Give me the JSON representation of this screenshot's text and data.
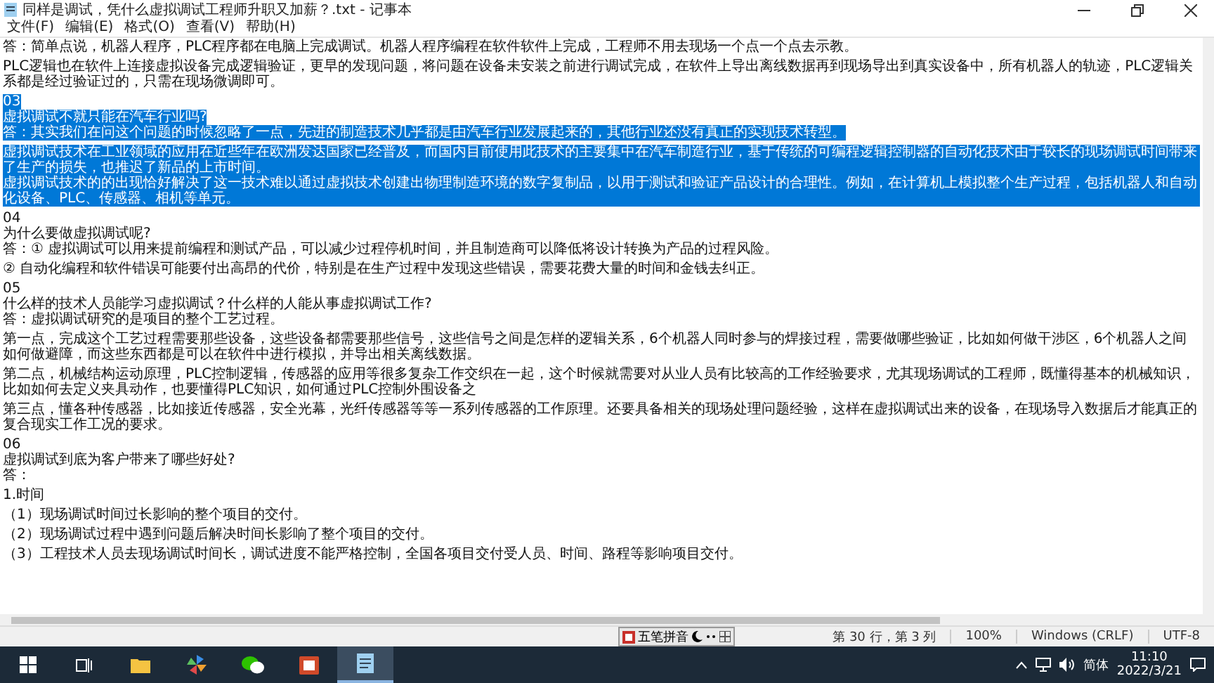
{
  "window": {
    "title": "同样是调试，凭什么虚拟调试工程师升职又加薪？.txt - 记事本"
  },
  "menu": [
    {
      "label": "文件(F)"
    },
    {
      "label": "编辑(E)"
    },
    {
      "label": "格式(O)"
    },
    {
      "label": "查看(V)"
    },
    {
      "label": "帮助(H)"
    }
  ],
  "document": {
    "blocks": [
      {
        "lines": [
          {
            "text": "答：简单点说，机器人程序，PLC程序都在电脑上完成调试。机器人程序编程在软件软件上完成，工程师不用去现场一个点一个点去示教。",
            "selected": false
          }
        ]
      },
      {
        "lines": [
          {
            "text": "PLC逻辑也在软件上连接虚拟设备完成逻辑验证，更早的发现问题，将问题在设备未安装之前进行调试完成，在软件上导出离线数据再到现场导出到真实设备中，所有机器人的轨迹，PLC逻辑关系都是经过验证过的，只需在现场微调即可。",
            "selected": false
          }
        ]
      },
      {
        "lines": [
          {
            "text": "03",
            "selected": true
          },
          {
            "text": "虚拟调试不就只能在汽车行业吗?",
            "selected": true
          },
          {
            "text": "答：其实我们在问这个问题的时候忽略了一点，先进的制造技术几乎都是由汽车行业发展起来的，其他行业还没有真正的实现技术转型。",
            "selected": true
          }
        ]
      },
      {
        "lines": [
          {
            "text": "虚拟调试技术在工业领域的应用在近些年在欧洲发达国家已经普及，而国内目前使用此技术的主要集中在汽车制造行业，基于传统的可编程逻辑控制器的自动化技术由于较长的现场调试时间带来了生产的损失，也推迟了新品的上市时间。",
            "selected": true
          },
          {
            "text": "虚拟调试技术的的出现恰好解决了这一技术难以通过虚拟技术创建出物理制造环境的数字复制品，以用于测试和验证产品设计的合理性。例如，在计算机上模拟整个生产过程，包括机器人和自动化设备、PLC、传感器、相机等单元。",
            "selected": true
          }
        ]
      },
      {
        "lines": [
          {
            "text": "04",
            "selected": false
          },
          {
            "text": "为什么要做虚拟调试呢?",
            "selected": false
          },
          {
            "text": "答：① 虚拟调试可以用来提前编程和测试产品，可以减少过程停机时间，并且制造商可以降低将设计转换为产品的过程风险。",
            "selected": false
          }
        ]
      },
      {
        "lines": [
          {
            "text": "② 自动化编程和软件错误可能要付出高昂的代价，特别是在生产过程中发现这些错误，需要花费大量的时间和金钱去纠正。",
            "selected": false
          }
        ]
      },
      {
        "lines": [
          {
            "text": "05",
            "selected": false
          },
          {
            "text": "什么样的技术人员能学习虚拟调试？什么样的人能从事虚拟调试工作?",
            "selected": false
          },
          {
            "text": "答：虚拟调试研究的是项目的整个工艺过程。",
            "selected": false
          }
        ]
      },
      {
        "lines": [
          {
            "text": "第一点，完成这个工艺过程需要那些设备，这些设备都需要那些信号，这些信号之间是怎样的逻辑关系，6个机器人同时参与的焊接过程，需要做哪些验证，比如如何做干涉区，6个机器人之间如何做避障，而这些东西都是可以在软件中进行模拟，并导出相关离线数据。",
            "selected": false
          }
        ]
      },
      {
        "lines": [
          {
            "text": "第二点，机械结构运动原理，PLC控制逻辑，传感器的应用等很多复杂工作交织在一起，这个时候就需要对从业人员有比较高的工作经验要求，尤其现场调试的工程师，既懂得基本的机械知识，比如如何去定义夹具动作，也要懂得PLC知识，如何通过PLC控制外围设备之",
            "selected": false
          }
        ]
      },
      {
        "lines": [
          {
            "text": "第三点，懂各种传感器，比如接近传感器，安全光幕，光纤传感器等等一系列传感器的工作原理。还要具备相关的现场处理问题经验，这样在虚拟调试出来的设备，在现场导入数据后才能真正的复合现实工作工况的要求。",
            "selected": false
          }
        ]
      },
      {
        "lines": [
          {
            "text": "06",
            "selected": false
          },
          {
            "text": "虚拟调试到底为客户带来了哪些好处?",
            "selected": false
          },
          {
            "text": "答：",
            "selected": false
          }
        ]
      },
      {
        "lines": [
          {
            "text": "1.时间",
            "selected": false
          }
        ]
      },
      {
        "lines": [
          {
            "text": "（1）现场调试时间过长影响的整个项目的交付。",
            "selected": false
          }
        ]
      },
      {
        "lines": [
          {
            "text": "（2）现场调试过程中遇到问题后解决时间长影响了整个项目的交付。",
            "selected": false
          }
        ]
      },
      {
        "lines": [
          {
            "text": "（3）工程技术人员去现场调试时间长，调试进度不能严格控制，全国各项目交付受人员、时间、路程等影响项目交付。",
            "selected": false
          }
        ]
      }
    ]
  },
  "ime_bar": {
    "label": "五笔拼音"
  },
  "status_bar": {
    "position": "第 30 行，第 3 列",
    "zoom": "100%",
    "line_ending": "Windows (CRLF)",
    "encoding": "UTF-8"
  },
  "taskbar": {
    "apps": [
      {
        "kind": "explorer",
        "active": false
      },
      {
        "kind": "pinwheel",
        "active": false
      },
      {
        "kind": "chat",
        "active": false
      },
      {
        "kind": "slides",
        "active": false
      },
      {
        "kind": "notepad",
        "active": true
      }
    ],
    "tray": {
      "language": "简体",
      "time": "11:10",
      "date": "2022/3/21"
    }
  }
}
